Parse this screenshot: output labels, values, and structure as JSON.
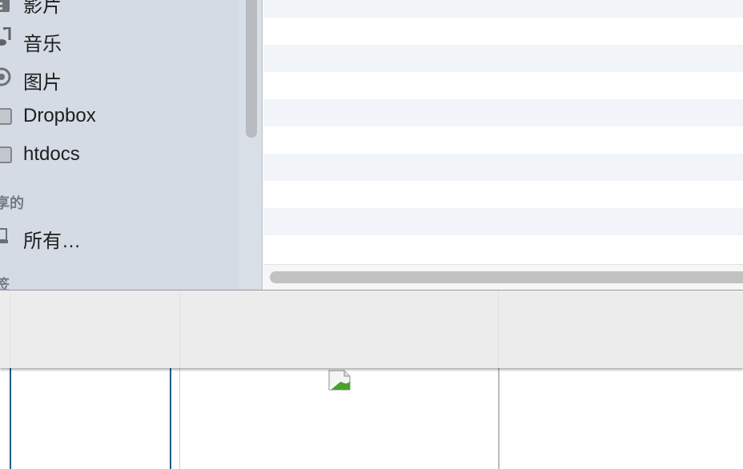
{
  "sidebar": {
    "items": [
      {
        "label": "影片",
        "icon": "movies-icon"
      },
      {
        "label": "音乐",
        "icon": "music-icon"
      },
      {
        "label": "图片",
        "icon": "camera-icon"
      },
      {
        "label": "Dropbox",
        "icon": "folder-icon"
      },
      {
        "label": "htdocs",
        "icon": "folder-icon"
      }
    ],
    "shared_header": "享的",
    "shared_items": [
      {
        "label": "所有…",
        "icon": "computer-icon"
      }
    ],
    "tags_header": "签"
  },
  "colors": {
    "sidebar_bg": "#d4dbe4",
    "stripe": "#f1f4f9",
    "toolbar_bg": "#ececec",
    "accent_line": "#1f5f86"
  }
}
